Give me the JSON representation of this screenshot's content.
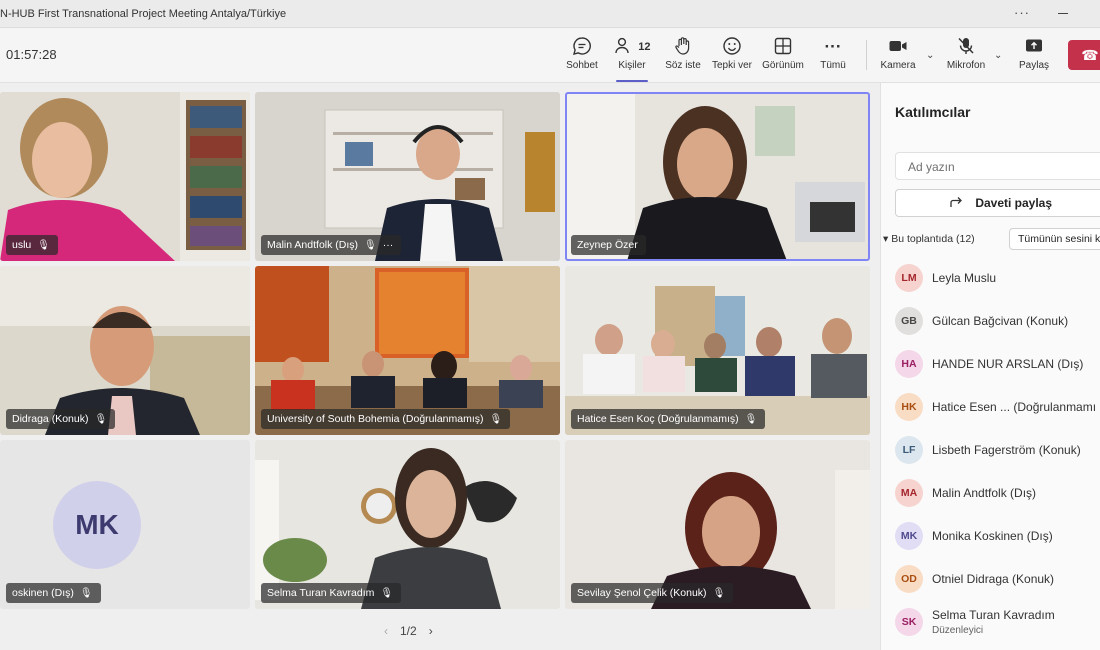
{
  "window": {
    "title": "N-HUB First Transnational Project Meeting Antalya/Türkiye",
    "more": "···"
  },
  "toolbar": {
    "timer": "01:57:28",
    "chat": "Sohbet",
    "people": "Kişiler",
    "people_count": "12",
    "raise_hand": "Söz iste",
    "react": "Tepki ver",
    "view": "Görünüm",
    "more": "Tümü",
    "camera": "Kamera",
    "mic": "Mikrofon",
    "share": "Paylaş"
  },
  "tiles": [
    {
      "name": "uslu"
    },
    {
      "name": "Malin Andtfolk (Dış)"
    },
    {
      "name": "Zeynep Özer"
    },
    {
      "name": "Didraga (Konuk)"
    },
    {
      "name": "University of South Bohemia (Doğrulanmamış)"
    },
    {
      "name": "Hatice Esen Koç (Doğrulanmamış)"
    },
    {
      "name": "oskinen (Dış)",
      "initials": "MK"
    },
    {
      "name": "Selma Turan Kavradım"
    },
    {
      "name": "Sevilay Şenol Çelik (Konuk)"
    }
  ],
  "pager": {
    "label": "1/2"
  },
  "panel": {
    "title": "Katılımcılar",
    "search_placeholder": "Ad yazın",
    "share_invite": "Daveti paylaş",
    "section": "Bu toplantıda (12)",
    "mute_all": "Tümünün sesini k",
    "participants": [
      {
        "initials": "LM",
        "name": "Leyla Muslu",
        "bg": "#f6d3cf",
        "fg": "#a4262c"
      },
      {
        "initials": "GB",
        "name": "Gülcan Bağcivan (Konuk)",
        "bg": "#e1dfdd",
        "fg": "#484644"
      },
      {
        "initials": "HA",
        "name": "HANDE NUR ARSLAN (Dış)",
        "bg": "#f4d7e8",
        "fg": "#9b1f63"
      },
      {
        "initials": "HK",
        "name": "Hatice Esen ... (Doğrulanmamı",
        "bg": "#f9dcc4",
        "fg": "#a84e12"
      },
      {
        "initials": "LF",
        "name": "Lisbeth Fagerström (Konuk)",
        "bg": "#dce6ee",
        "fg": "#3a5a78"
      },
      {
        "initials": "MA",
        "name": "Malin Andtfolk (Dış)",
        "bg": "#f6d3cf",
        "fg": "#a4262c"
      },
      {
        "initials": "MK",
        "name": "Monika Koskinen (Dış)",
        "bg": "#e0ddf4",
        "fg": "#4f4a8c"
      },
      {
        "initials": "OD",
        "name": "Otniel Didraga (Konuk)",
        "bg": "#f9dcc4",
        "fg": "#a84e12"
      },
      {
        "initials": "SK",
        "name": "Selma Turan Kavradım",
        "role": "Düzenleyici",
        "bg": "#f4d7e8",
        "fg": "#9b1f63"
      }
    ]
  }
}
